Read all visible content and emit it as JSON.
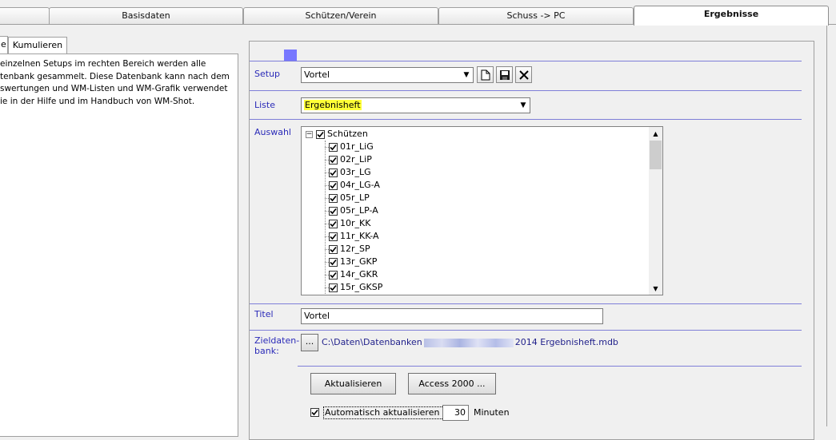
{
  "top_tabs": [
    {
      "label": "Basisdaten"
    },
    {
      "label": "Schützen/Verein"
    },
    {
      "label": "Schuss -> PC"
    },
    {
      "label": "Ergebnisse"
    }
  ],
  "left_tabs": [
    {
      "label": "e"
    },
    {
      "label": "Kumulieren"
    }
  ],
  "left_description": "einzelnen Setups im rechten Bereich werden alle\ntenbank gesammelt. Diese Datenbank kann nach dem\nswertungen und WM-Listen und WM-Grafik verwendet\nie in der Hilfe und im Handbuch von WM-Shot.",
  "accent_color": "#7777ff",
  "setup": {
    "label": "Setup",
    "value": "Vortel",
    "icons": [
      "new-document-icon",
      "save-disk-icon",
      "delete-x-icon"
    ]
  },
  "liste": {
    "label": "Liste",
    "value": "Ergebnisheft"
  },
  "auswahl": {
    "label": "Auswahl",
    "root": {
      "label": "Schützen",
      "checked": true,
      "expanded": true
    },
    "items": [
      {
        "label": "01r_LiG",
        "checked": true
      },
      {
        "label": "02r_LiP",
        "checked": true
      },
      {
        "label": "03r_LG",
        "checked": true
      },
      {
        "label": "04r_LG-A",
        "checked": true
      },
      {
        "label": "05r_LP",
        "checked": true
      },
      {
        "label": "05r_LP-A",
        "checked": true
      },
      {
        "label": "10r_KK",
        "checked": true
      },
      {
        "label": "11r_KK-A",
        "checked": true
      },
      {
        "label": "12r_SP",
        "checked": true
      },
      {
        "label": "13r_GKP",
        "checked": true
      },
      {
        "label": "14r_GKR",
        "checked": true
      },
      {
        "label": "15r_GKSP",
        "checked": true
      }
    ]
  },
  "titel": {
    "label": "Titel",
    "value": "Vortel"
  },
  "zieldatenbank": {
    "label_line1": "Zieldaten-",
    "label_line2": "bank:",
    "browse_label": "...",
    "path_prefix": "C:\\Daten\\Datenbanken",
    "path_suffix": "2014 Ergebnisheft.mdb"
  },
  "buttons": {
    "aktualisieren": "Aktualisieren",
    "access": "Access 2000 ..."
  },
  "auto_update": {
    "label": "Automatisch aktualisieren alle",
    "checked": true,
    "minutes": "30",
    "unit": "Minuten"
  }
}
